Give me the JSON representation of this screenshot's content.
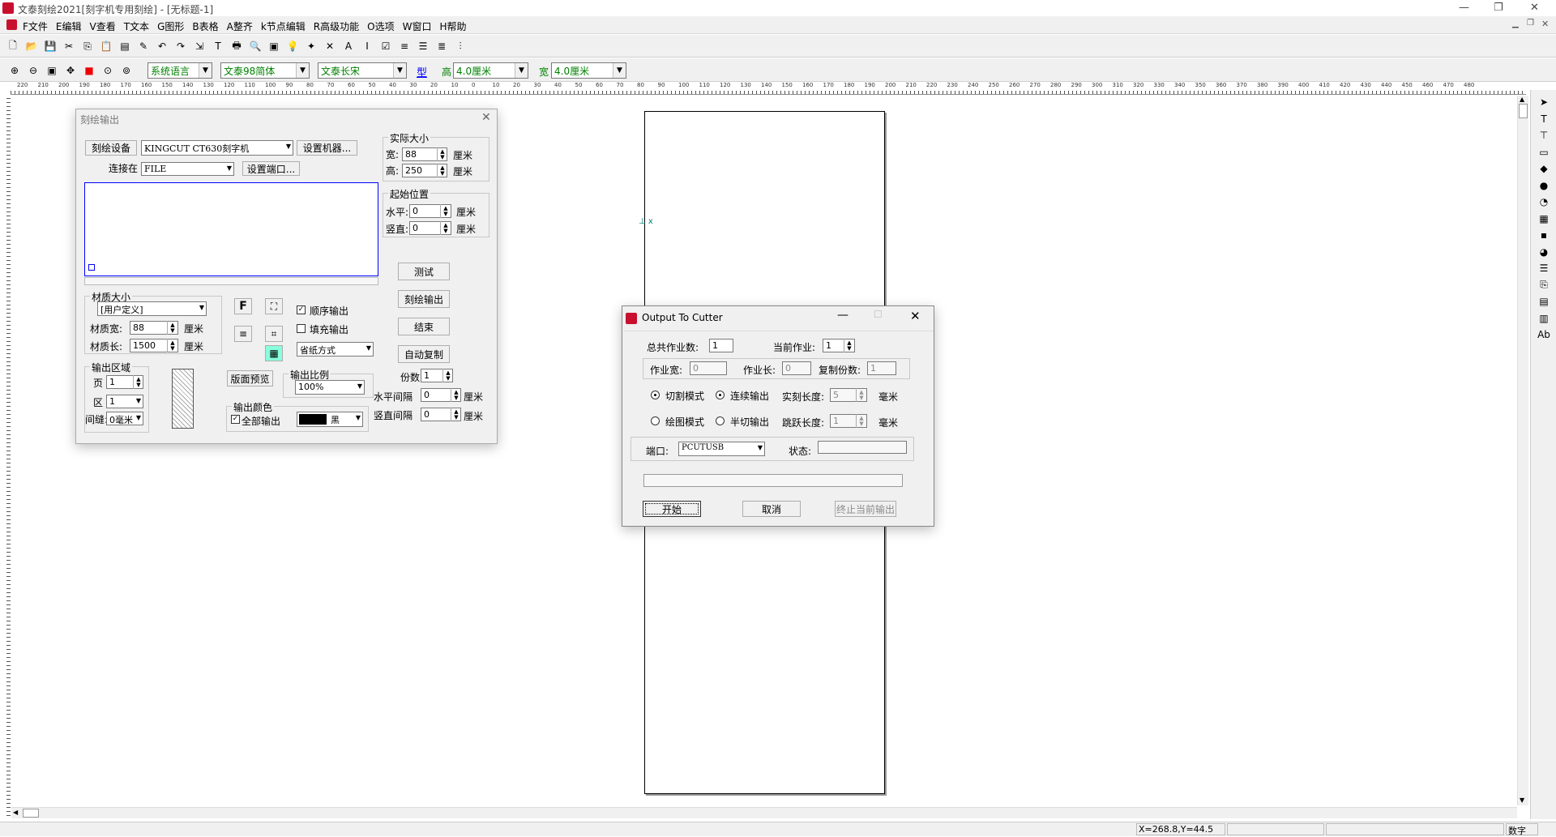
{
  "titlebar": {
    "title": "文泰刻绘2021[刻字机专用刻绘] - [无标题-1]"
  },
  "menu": [
    "F文件",
    "E编辑",
    "V查看",
    "T文本",
    "G图形",
    "B表格",
    "A整齐",
    "k节点编辑",
    "R高级功能",
    "O选项",
    "W窗口",
    "H帮助"
  ],
  "toolbar2": {
    "language": "系统语言",
    "font_cn": "文泰98简体",
    "font_en": "文泰长宋",
    "type_btn": "型",
    "height_label": "高",
    "height_value": "4.0厘米",
    "width_label": "宽",
    "width_value": "4.0厘米"
  },
  "engrave": {
    "title": "刻绘输出",
    "device_btn": "刻绘设备",
    "device_value": "KINGCUT CT630刻字机",
    "setup_machine_btn": "设置机器...",
    "connect_label": "连接在",
    "connect_value": "FILE",
    "setup_port_btn": "设置端口...",
    "actual_size": "实际大小",
    "width_label": "宽:",
    "width_value": "88",
    "height_label": "高:",
    "height_value": "250",
    "unit_cm": "厘米",
    "start_pos": "起始位置",
    "horiz_label": "水平:",
    "horiz_value": "0",
    "vert_label": "竖直:",
    "vert_value": "0",
    "test_btn": "测试",
    "output_btn": "刻绘输出",
    "end_btn": "结束",
    "auto_copy_btn": "自动复制",
    "material_size": "材质大小",
    "material_type": "[用户定义]",
    "mat_width_label": "材质宽:",
    "mat_width_value": "88",
    "mat_length_label": "材质长:",
    "mat_length_value": "1500",
    "seq_output": "顺序输出",
    "fill_output": "填充输出",
    "paper_mode": "省纸方式",
    "output_area": "输出区域",
    "page_label": "页",
    "page_value": "1",
    "zone_label": "区",
    "zone_value": "1",
    "gap_label": "间缝:",
    "gap_value": "0毫米",
    "preview_btn": "版面预览",
    "scale_label": "输出比例",
    "scale_value": "100%",
    "copies_label": "份数",
    "copies_value": "1",
    "h_gap_label": "水平间隔",
    "h_gap_value": "0",
    "v_gap_label": "竖直间隔",
    "v_gap_value": "0",
    "color_label": "输出颜色",
    "all_output": "全部输出",
    "color_value": "黑",
    "f_btn": "F"
  },
  "cutter": {
    "title": "Output To Cutter",
    "total_jobs_label": "总共作业数:",
    "total_jobs_value": "1",
    "current_job_label": "当前作业:",
    "current_job_value": "1",
    "job_width_label": "作业宽:",
    "job_width_value": "0",
    "job_length_label": "作业长:",
    "job_length_value": "0",
    "copies_label": "复制份数:",
    "copies_value": "1",
    "cut_mode": "切割模式",
    "continuous": "连续输出",
    "real_len_label": "实刻长度:",
    "real_len_value": "5",
    "unit_mm": "毫米",
    "plot_mode": "绘图模式",
    "half_cut": "半切输出",
    "skip_len_label": "跳跃长度:",
    "skip_len_value": "1",
    "port_label": "端口:",
    "port_value": "PCUTUSB",
    "status_label": "状态:",
    "start_btn": "开始",
    "cancel_btn": "取消",
    "stop_btn": "终止当前输出"
  },
  "status": {
    "coords": "X=268.8,Y=44.5",
    "mode": "数字"
  },
  "ruler_labels": [
    "220",
    "210",
    "200",
    "190",
    "180",
    "170",
    "160",
    "150",
    "140",
    "130",
    "120",
    "110",
    "100",
    "90",
    "80",
    "70",
    "60",
    "50",
    "40",
    "30",
    "20",
    "10",
    "0",
    "10",
    "20",
    "30",
    "40",
    "50",
    "60",
    "70",
    "80",
    "90",
    "100",
    "110",
    "120",
    "130",
    "140",
    "150",
    "160",
    "170",
    "180",
    "190",
    "200",
    "210",
    "220",
    "230",
    "240",
    "250",
    "260",
    "270",
    "280",
    "290",
    "300",
    "310",
    "320",
    "330",
    "340",
    "350",
    "360",
    "370",
    "380",
    "390",
    "400",
    "410",
    "420",
    "430",
    "440",
    "450",
    "460",
    "470",
    "480"
  ]
}
